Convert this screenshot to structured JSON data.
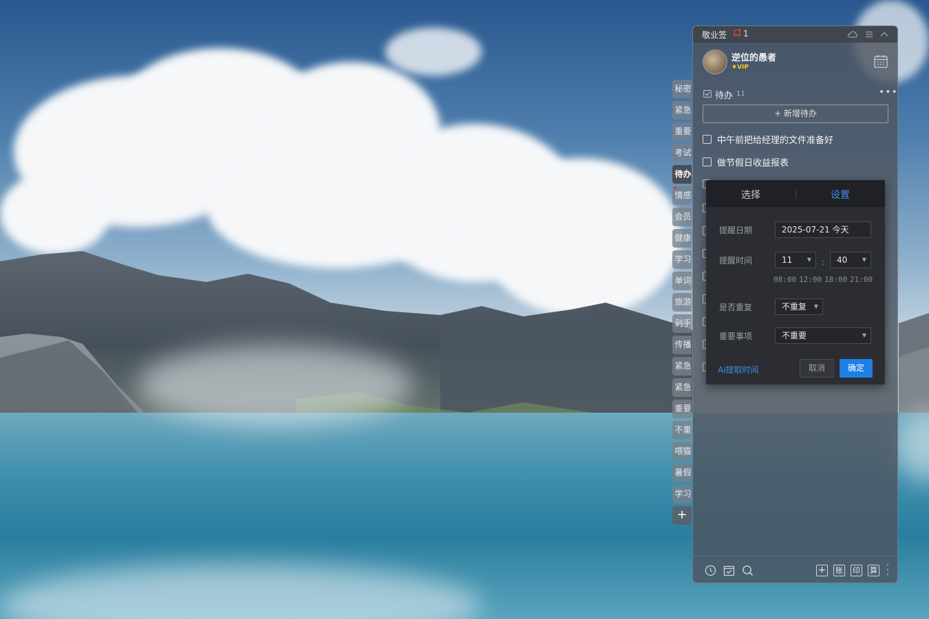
{
  "panel": {
    "app_title": "敬业签",
    "notification_count": "1",
    "user": {
      "name": "逆位的愚者",
      "badge": "VIP"
    }
  },
  "tabs": [
    "秘密",
    "紧急",
    "重要",
    "考试",
    "待办",
    "情感",
    "会员",
    "健康",
    "学习",
    "单词",
    "旅游",
    "剁手",
    "传播",
    "紧急",
    "紧急",
    "重要",
    "不重",
    "喂猫",
    "暑假",
    "学习"
  ],
  "active_tab": "待办",
  "add_tab_label": "+",
  "todo": {
    "title": "待办",
    "count": "11",
    "add_button": "+ 新增待办",
    "items": [
      "中午前把给经理的文件准备好",
      "做节假日收益报表"
    ]
  },
  "reminder_popup": {
    "tab_select": "选择",
    "tab_settings": "设置",
    "date_label": "提醒日期",
    "date_value": "2025-07-21 今天",
    "time_label": "提醒时间",
    "hour_value": "11",
    "minute_value": "40",
    "time_separator": ":",
    "quick_times": [
      "08:00",
      "12:00",
      "18:00",
      "21:00"
    ],
    "repeat_label": "是否重复",
    "repeat_value": "不重复",
    "importance_label": "重要事项",
    "importance_value": "不重要",
    "ai_link": "Ai提取时间",
    "cancel_label": "取消",
    "confirm_label": "确定"
  },
  "bottom_bar": {
    "account_label": "账",
    "print_label": "印",
    "calc_label": "算"
  },
  "colors": {
    "accent": "#1e7fe6",
    "link": "#3a8fe8",
    "vip": "#f4c430",
    "bell": "#e0403a"
  }
}
